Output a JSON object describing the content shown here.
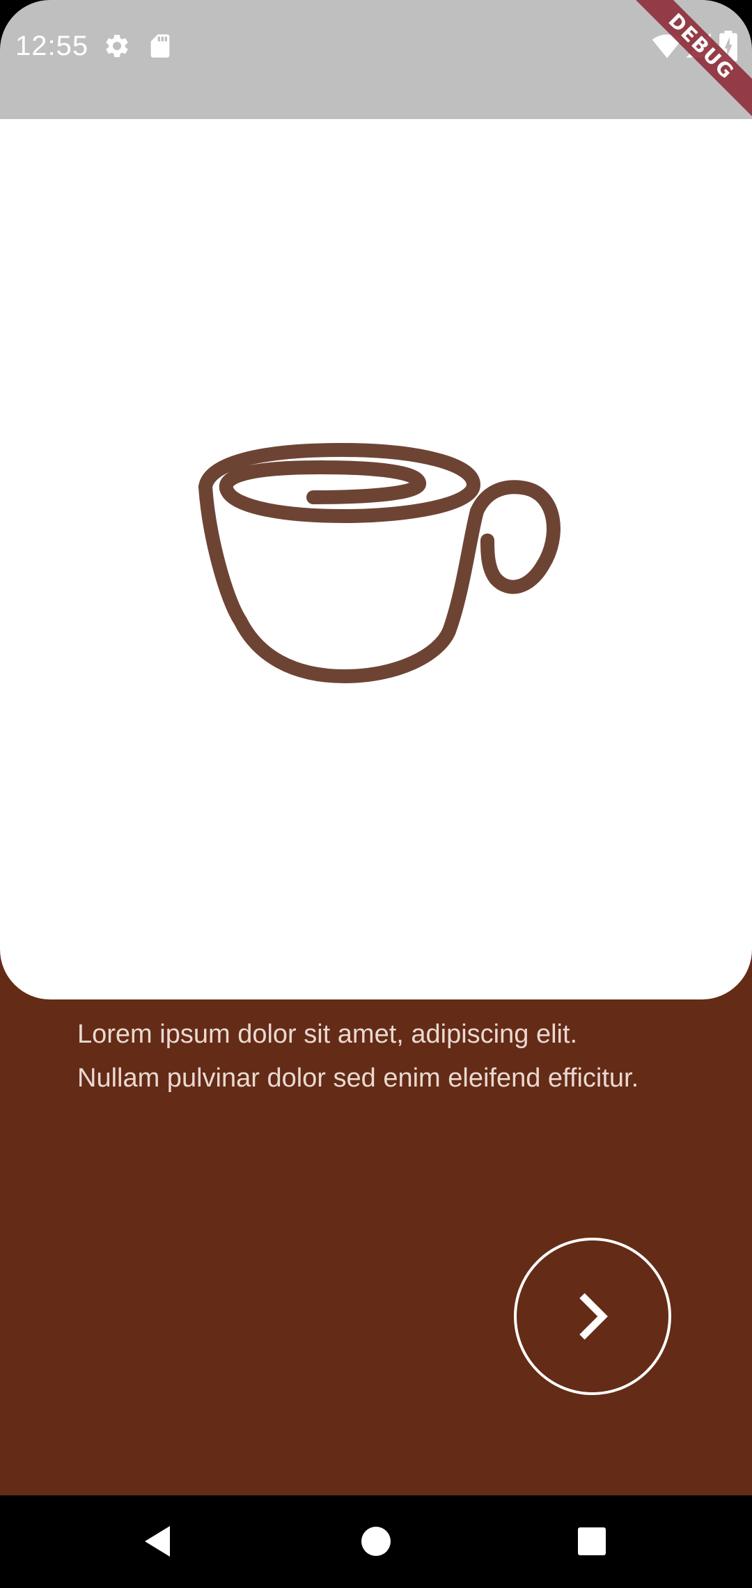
{
  "status_bar": {
    "time": "12:55",
    "left_icons": [
      "gear-icon",
      "sd-card-icon"
    ],
    "right_icons": [
      "wifi-icon",
      "cell-signal-icon",
      "battery-charging-icon"
    ],
    "debug_label": "DEBUG"
  },
  "hero": {
    "illustration": "coffee-cup-icon"
  },
  "content": {
    "description": "Lorem ipsum dolor sit amet, adipiscing elit. Nullam pulvinar dolor sed enim eleifend efficitur."
  },
  "next_button": {
    "icon": "chevron-right-icon"
  },
  "nav_bar": {
    "buttons": [
      "back-icon",
      "home-icon",
      "recents-icon"
    ]
  },
  "colors": {
    "background": "#642b16",
    "card": "#ffffff",
    "cup_stroke": "#6d4434",
    "status_bar": "#bfbfbf",
    "debug_banner": "#8e2d3a",
    "text": "#ead9d2"
  }
}
